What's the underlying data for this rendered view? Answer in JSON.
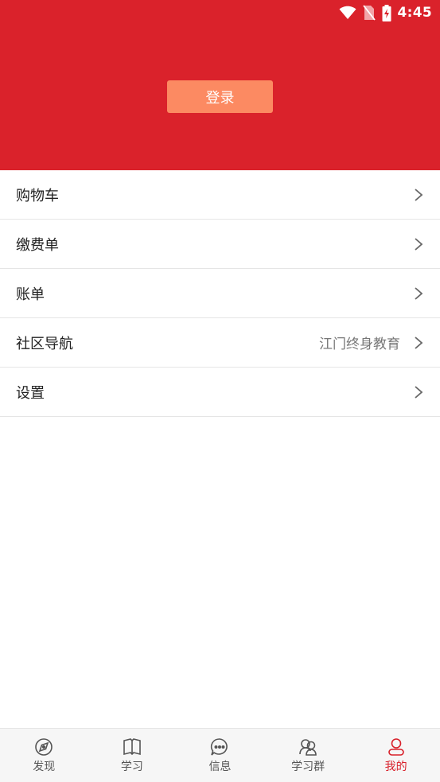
{
  "status_bar": {
    "time": "4:45"
  },
  "header": {
    "login_label": "登录",
    "background_color": "#da222b",
    "button_color": "#fc8a62"
  },
  "menu": {
    "items": [
      {
        "label": "购物车",
        "value": ""
      },
      {
        "label": "缴费单",
        "value": ""
      },
      {
        "label": "账单",
        "value": ""
      },
      {
        "label": "社区导航",
        "value": "江门终身教育"
      },
      {
        "label": "设置",
        "value": ""
      }
    ]
  },
  "tabbar": {
    "active_color": "#d8202a",
    "items": [
      {
        "label": "发现",
        "icon": "compass-icon",
        "active": false
      },
      {
        "label": "学习",
        "icon": "book-icon",
        "active": false
      },
      {
        "label": "信息",
        "icon": "chat-bubble-icon",
        "active": false
      },
      {
        "label": "学习群",
        "icon": "group-icon",
        "active": false
      },
      {
        "label": "我的",
        "icon": "user-icon",
        "active": true
      }
    ]
  }
}
